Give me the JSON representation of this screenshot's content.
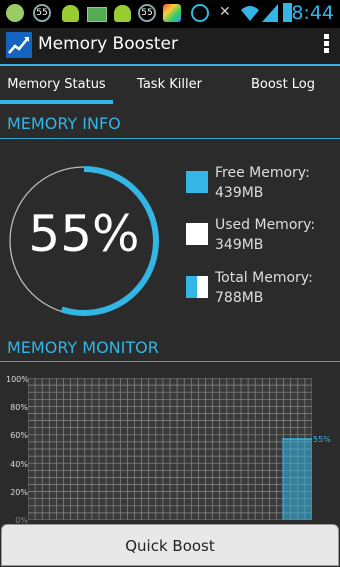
{
  "status_bar": {
    "time": "8:44",
    "badge_left": "55",
    "badge_right": "55",
    "icons": [
      "plus-circle-icon",
      "badge-55-icon",
      "android-icon",
      "battery-green-icon",
      "android-icon",
      "badge-55-icon",
      "colorful-app-icon",
      "power-circle-icon",
      "mute-icon",
      "wifi-icon",
      "signal-icon",
      "battery-charging-icon"
    ]
  },
  "app": {
    "title": "Memory Booster",
    "icon": "chart-trend-icon"
  },
  "tabs": [
    {
      "label": "Memory Status",
      "active": true
    },
    {
      "label": "Task Killer",
      "active": false
    },
    {
      "label": "Boost Log",
      "active": false
    }
  ],
  "memory_info": {
    "title": "MEMORY INFO",
    "percent_label": "55%",
    "usage_fraction": 0.55,
    "free_label": "Free Memory:",
    "free_value": "439MB",
    "used_label": "Used Memory:",
    "used_value": "349MB",
    "total_label": "Total Memory:",
    "total_value": "788MB"
  },
  "memory_monitor": {
    "title": "MEMORY MONITOR",
    "y_ticks": [
      "100%",
      "80%",
      "60%",
      "40%",
      "20%",
      "0%"
    ],
    "current_label": "55%",
    "current_fraction": 0.57
  },
  "actions": {
    "quick_boost": "Quick Boost"
  },
  "colors": {
    "accent": "#33b5e5",
    "background": "#2b2b2b"
  }
}
